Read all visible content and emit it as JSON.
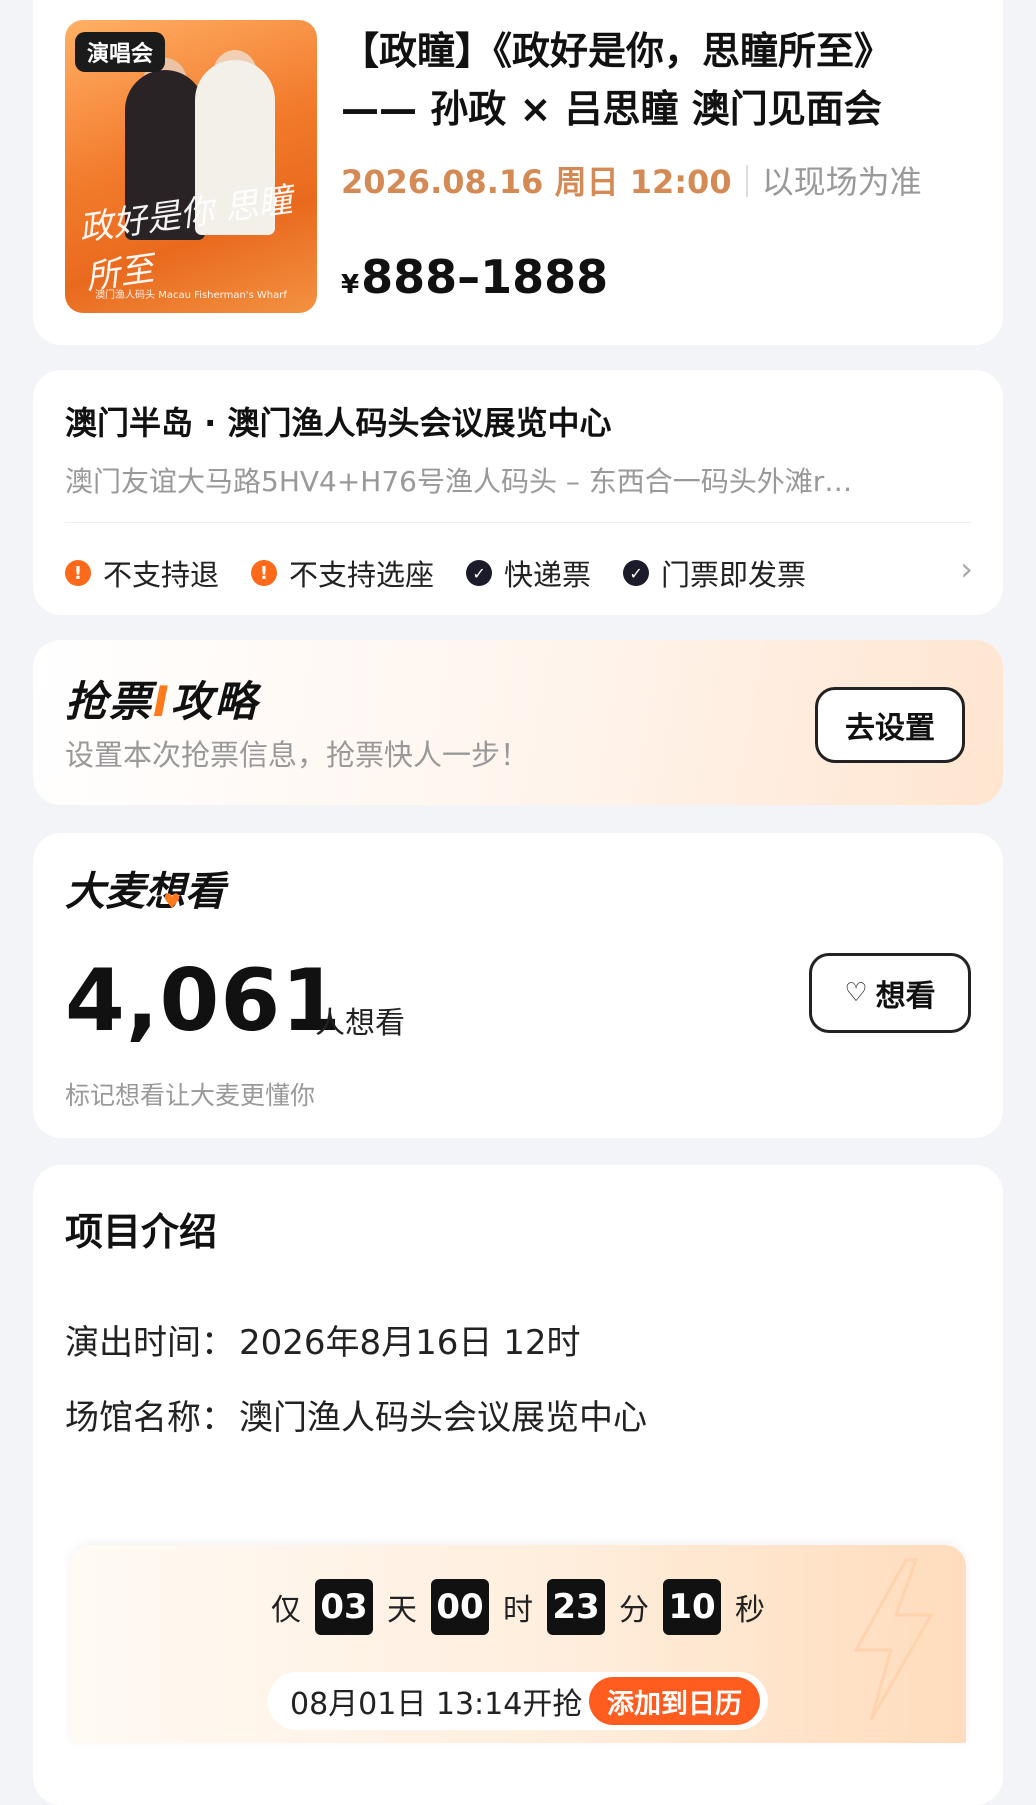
{
  "event": {
    "badge": "演唱会",
    "poster_script": "政好是你 思瞳所至",
    "poster_footer": "澳门渔人码头 Macau Fisherman's Wharf",
    "title_line1": "【政瞳】《政好是你，思瞳所至》",
    "title_line2": "—— 孙政 × 吕思瞳 澳门见面会",
    "date": "2026.08.16 周日 12:00",
    "date_note": "以现场为准",
    "currency": "¥",
    "price": "888–1888"
  },
  "venue": {
    "name": "澳门半岛 · 澳门渔人码头会议展览中心",
    "address": "澳门友谊大马路5HV4+H76号渔人码头 – 东西合一码头外滩r…",
    "tags": [
      {
        "label": "不支持退",
        "icon": "warning-icon"
      },
      {
        "label": "不支持选座",
        "icon": "warning-icon"
      },
      {
        "label": "快递票",
        "icon": "check-icon"
      },
      {
        "label": "门票即发票",
        "icon": "check-icon"
      }
    ]
  },
  "strategy": {
    "title_a": "抢票",
    "title_hl": "I",
    "title_b": "攻略",
    "subtitle": "设置本次抢票信息，抢票快人一步！",
    "button": "去设置"
  },
  "want": {
    "title": "大麦想看",
    "count": "4,061",
    "unit": "人想看",
    "hint": "标记想看让大麦更懂你",
    "button": "想看"
  },
  "intro": {
    "title": "项目介绍",
    "time_label": "演出时间：",
    "time_value": "2026年8月16日 12时",
    "venue_label": "场馆名称：",
    "venue_value": "澳门渔人码头会议展览中心"
  },
  "countdown": {
    "prefix": "仅",
    "days": "03",
    "days_unit": "天",
    "hours": "00",
    "hours_unit": "时",
    "minutes": "23",
    "minutes_unit": "分",
    "seconds": "10",
    "seconds_unit": "秒",
    "start_text": "08月01日 13:14开抢",
    "calendar_button": "添加到日历"
  },
  "colors": {
    "accent": "#ff7a1a",
    "date": "#d48a55",
    "cta": "#ff5c1f"
  }
}
